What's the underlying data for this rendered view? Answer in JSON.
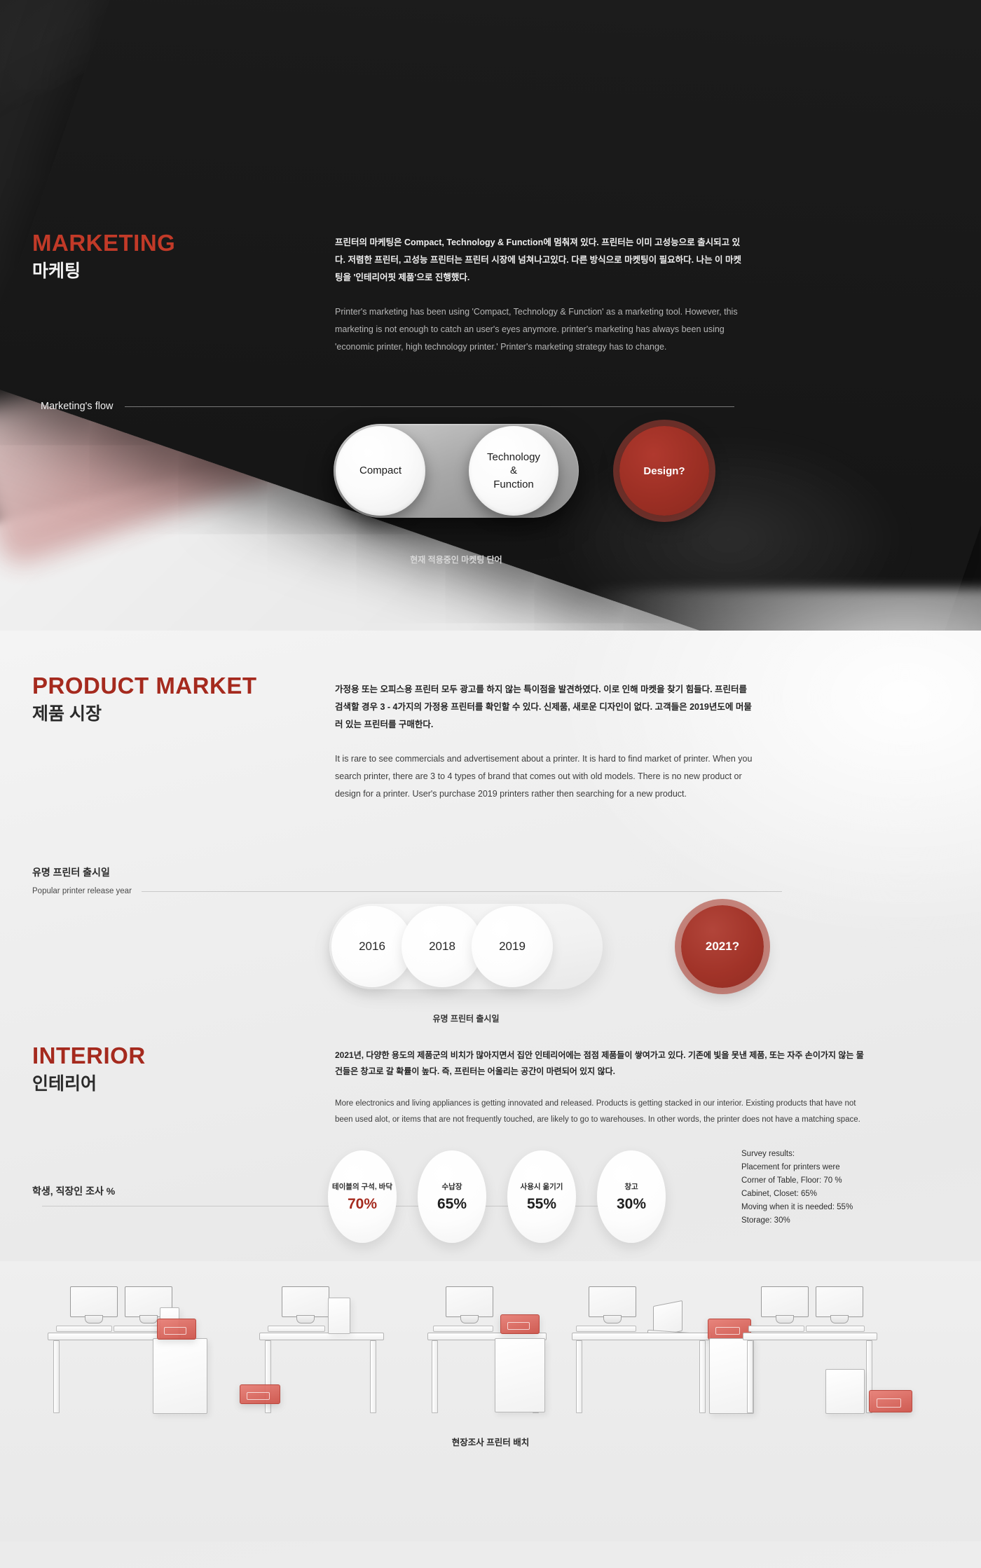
{
  "marketing": {
    "heading_en": "MARKETING",
    "heading_ko": "마케팅",
    "para_ko": "프린터의 마케팅은 Compact, Technology & Function에 멈춰져 있다. 프린터는 이미 고성능으로 출시되고 있다. 저렴한 프린터, 고성능 프린터는 프린터 시장에 넘쳐나고있다. 다른 방식으로 마켓팅이 필요하다. 나는 이 마켓팅을 '인테리어핏 제품'으로 진행했다.",
    "para_en": "Printer's marketing has been using 'Compact, Technology & Function' as a marketing tool. However, this marketing is not enough to catch an user's eyes anymore. printer's marketing has always been using 'economic printer, high technology printer.' Printer's marketing strategy has to change.",
    "flow_label": "Marketing's flow",
    "flow_nodes": [
      {
        "label": "Compact"
      },
      {
        "label": "Technology\n&\nFunction"
      }
    ],
    "flow_highlight": "Design?",
    "flow_caption": "현재 적용중인 마켓팅 단어"
  },
  "product_market": {
    "heading_en": "PRODUCT MARKET",
    "heading_ko": "제품 시장",
    "para_ko": "가정용 또는 오피스용 프린터 모두 광고를 하지 않는 특이점을 발견하였다. 이로 인해 마켓을 찾기 힘들다. 프린터를 검색할 경우 3 - 4가지의 가정용 프린터를 확인할 수 있다. 신제품, 새로운 디자인이 없다. 고객들은 2019년도에 머물러 있는 프린터를 구매한다.",
    "para_en": "It is rare to see commercials and advertisement about a printer. It is hard to find market of printer. When you search printer, there are 3 to 4 types of brand that comes out with old models. There is no new product or design for a printer. User's purchase 2019 printers rather then searching for a new product."
  },
  "timeline": {
    "label_ko": "유명 프린터 출시일",
    "label_en": "Popular printer release year",
    "years": [
      "2016",
      "2018",
      "2019"
    ],
    "highlight_year": "2021?",
    "caption": "유명 프린터 출시일"
  },
  "interior": {
    "heading_en": "INTERIOR",
    "heading_ko": "인테리어",
    "para_ko": "2021년, 다양한 용도의 제품군의 비치가 많아지면서 집안 인테리어에는 점점 제품들이 쌓여가고 있다. 기존에 빛을 못낸 제품, 또는 자주 손이가지 않는 물건들은 창고로 갈 확률이 높다. 즉, 프린터는 어울리는 공간이 마련되어 있지 않다.",
    "para_en": "More electronics and living appliances is getting innovated and released. Products is getting stacked in our interior. Existing products that have not been used alot, or items that are not frequently touched, are likely to go to warehouses. In other words, the printer does not have a matching space."
  },
  "survey": {
    "label_ko": "학생, 직장인 조사 %",
    "label_en": "",
    "chart_data": {
      "type": "bar",
      "title": "학생, 직장인 조사 %",
      "categories": [
        "테이블의 구석, 바닥",
        "수납장",
        "사용시 옮기기",
        "창고"
      ],
      "values": [
        70,
        65,
        55,
        30
      ],
      "value_labels": [
        "70%",
        "65%",
        "55%",
        "30%"
      ],
      "ylim": [
        0,
        100
      ],
      "ylabel": "%",
      "xlabel": "",
      "accent_index": 0,
      "accent_color": "#a52a1e"
    },
    "items": [
      {
        "label": "테이블의 구석, 바닥",
        "value": "70%"
      },
      {
        "label": "수납장",
        "value": "65%"
      },
      {
        "label": "사용시 옮기기",
        "value": "55%"
      },
      {
        "label": "창고",
        "value": "30%"
      }
    ],
    "results_text": "Survey results:\nPlacement for printers were\nCorner of Table, Floor: 70 %\nCabinet, Closet: 65%\nMoving when it is needed: 55%\nStorage: 30%"
  },
  "scene": {
    "caption": "현장조사 프린터 배치"
  },
  "colors": {
    "accent_red_dark_bg": "#c23a28",
    "accent_red_light_bg": "#a52a1e",
    "printer_red": "#cd5046"
  }
}
